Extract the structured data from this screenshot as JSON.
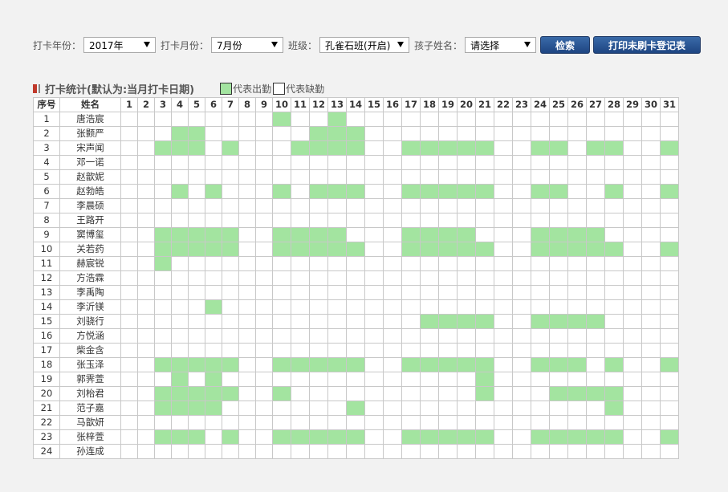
{
  "filters": {
    "year_label": "打卡年份：",
    "year_value": "2017年",
    "month_label": "打卡月份：",
    "month_value": "7月份",
    "class_label": "班级：",
    "class_value": "孔雀石班(开启)",
    "child_label": "孩子姓名：",
    "child_value": "请选择",
    "search_button": "检索",
    "print_button": "打印未刷卡登记表"
  },
  "legend": {
    "title": "打卡统计(默认为:当月打卡日期)",
    "present_label": "代表出勤",
    "absent_label": "代表缺勤",
    "present_color": "#a3e4a0",
    "absent_color": "#ffffff"
  },
  "table": {
    "header_no": "序号",
    "header_name": "姓名",
    "days": [
      "1",
      "2",
      "3",
      "4",
      "5",
      "6",
      "7",
      "8",
      "9",
      "10",
      "11",
      "12",
      "13",
      "14",
      "15",
      "16",
      "17",
      "18",
      "19",
      "20",
      "21",
      "22",
      "23",
      "24",
      "25",
      "26",
      "27",
      "28",
      "29",
      "30",
      "31"
    ],
    "rows": [
      {
        "no": "1",
        "name": "唐浩宸",
        "present": [
          10,
          13
        ]
      },
      {
        "no": "2",
        "name": "张颢严",
        "present": [
          4,
          5,
          12,
          13,
          14
        ]
      },
      {
        "no": "3",
        "name": "宋声闻",
        "present": [
          3,
          4,
          5,
          7,
          11,
          12,
          13,
          14,
          17,
          18,
          19,
          20,
          21,
          24,
          25,
          27,
          28,
          31
        ]
      },
      {
        "no": "4",
        "name": "邓一诺",
        "present": []
      },
      {
        "no": "5",
        "name": "赵歆妮",
        "present": []
      },
      {
        "no": "6",
        "name": "赵勃皓",
        "present": [
          4,
          6,
          10,
          12,
          13,
          14,
          17,
          18,
          19,
          20,
          21,
          24,
          25,
          28,
          31
        ]
      },
      {
        "no": "7",
        "name": "李晨硕",
        "present": []
      },
      {
        "no": "8",
        "name": "王路开",
        "present": []
      },
      {
        "no": "9",
        "name": "窦博玺",
        "present": [
          3,
          4,
          5,
          6,
          7,
          10,
          11,
          12,
          13,
          17,
          18,
          19,
          20,
          24,
          25,
          26,
          27
        ]
      },
      {
        "no": "10",
        "name": "关若药",
        "present": [
          3,
          4,
          5,
          6,
          7,
          10,
          11,
          12,
          13,
          14,
          17,
          18,
          19,
          20,
          21,
          24,
          25,
          26,
          27,
          28,
          31
        ]
      },
      {
        "no": "11",
        "name": "赫宸锐",
        "present": [
          3
        ]
      },
      {
        "no": "12",
        "name": "方浩霖",
        "present": []
      },
      {
        "no": "13",
        "name": "李禹陶",
        "present": []
      },
      {
        "no": "14",
        "name": "李沂镁",
        "present": [
          6
        ]
      },
      {
        "no": "15",
        "name": "刘骁行",
        "present": [
          18,
          19,
          20,
          21,
          24,
          25,
          26,
          27
        ]
      },
      {
        "no": "16",
        "name": "方悦涵",
        "present": []
      },
      {
        "no": "17",
        "name": "柴金含",
        "present": []
      },
      {
        "no": "18",
        "name": "张玉泽",
        "present": [
          3,
          4,
          5,
          6,
          7,
          10,
          11,
          12,
          13,
          14,
          17,
          18,
          19,
          20,
          21,
          24,
          25,
          26,
          28,
          31
        ]
      },
      {
        "no": "19",
        "name": "郭霁萱",
        "present": [
          4,
          6,
          21
        ]
      },
      {
        "no": "20",
        "name": "刘枱君",
        "present": [
          3,
          4,
          5,
          6,
          7,
          10,
          21,
          25,
          26,
          27,
          28
        ]
      },
      {
        "no": "21",
        "name": "范子嘉",
        "present": [
          3,
          4,
          5,
          6,
          14,
          28
        ]
      },
      {
        "no": "22",
        "name": "马歆妍",
        "present": []
      },
      {
        "no": "23",
        "name": "张梓萱",
        "present": [
          3,
          4,
          5,
          7,
          10,
          11,
          12,
          13,
          14,
          17,
          18,
          19,
          20,
          21,
          24,
          25,
          26,
          27,
          28,
          31
        ]
      },
      {
        "no": "24",
        "name": "孙连成",
        "present": []
      }
    ]
  }
}
